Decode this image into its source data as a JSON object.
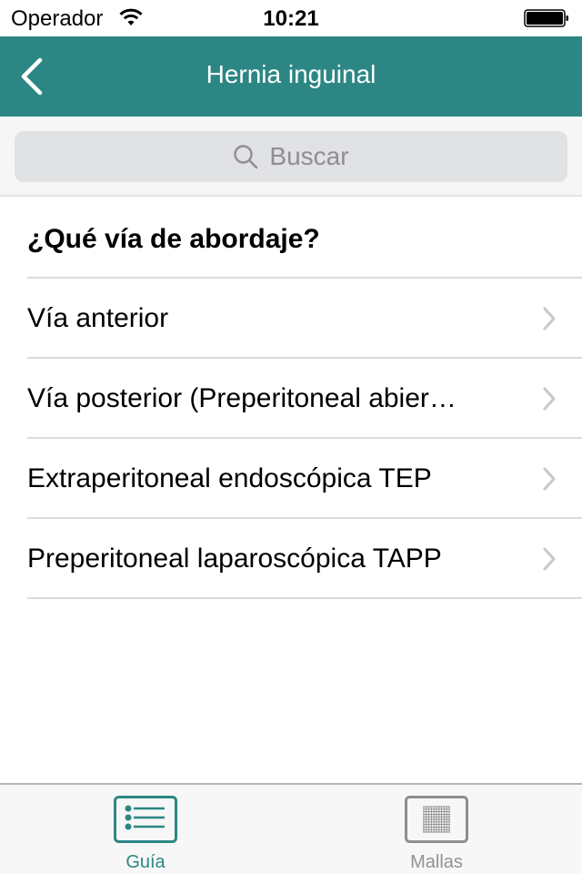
{
  "status_bar": {
    "carrier": "Operador",
    "time": "10:21",
    "wifi_icon": "wifi-icon",
    "battery_icon": "battery-full-icon"
  },
  "nav_bar": {
    "title": "Hernia inguinal",
    "back_icon": "chevron-left-icon",
    "background_color": "#2c8784"
  },
  "search": {
    "placeholder": "Buscar",
    "icon": "search-icon"
  },
  "list": {
    "section_header": "¿Qué vía de abordaje?",
    "items": [
      {
        "label": "Vía anterior",
        "icon": "chevron-right-icon"
      },
      {
        "label": "Vía posterior (Preperitoneal abier…",
        "icon": "chevron-right-icon"
      },
      {
        "label": "Extraperitoneal endoscópica TEP",
        "icon": "chevron-right-icon"
      },
      {
        "label": "Preperitoneal laparoscópica TAPP",
        "icon": "chevron-right-icon"
      }
    ]
  },
  "tab_bar": {
    "tabs": [
      {
        "label": "Guía",
        "icon": "list-icon",
        "selected": true,
        "color": "#2c8784"
      },
      {
        "label": "Mallas",
        "icon": "mesh-grid-icon",
        "selected": false,
        "color": "#929292"
      }
    ]
  }
}
